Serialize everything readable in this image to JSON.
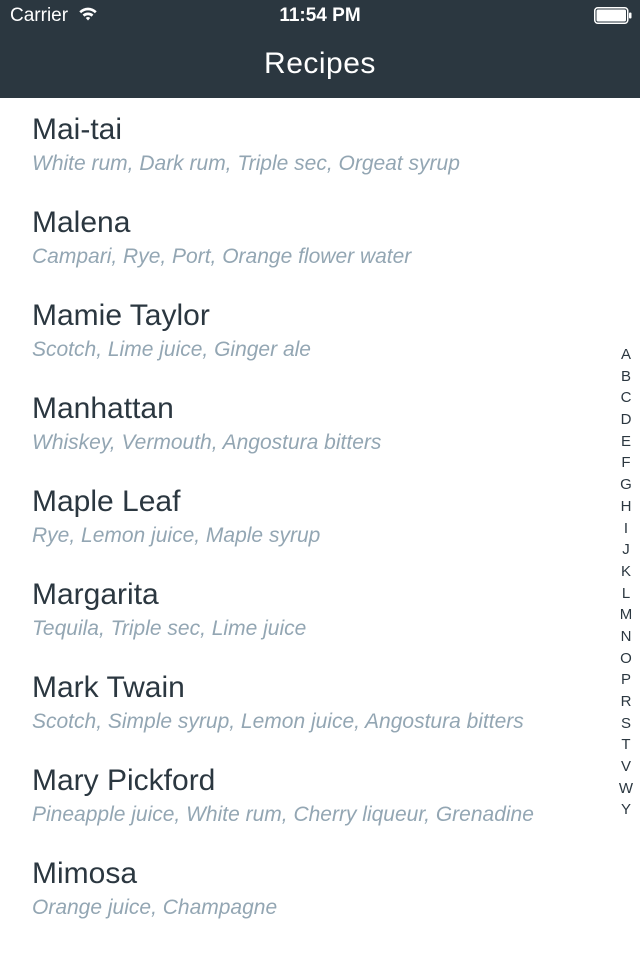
{
  "status_bar": {
    "carrier": "Carrier",
    "time": "11:54 PM",
    "wifi_icon": "wifi-icon",
    "battery_icon": "battery-icon"
  },
  "nav": {
    "title": "Recipes"
  },
  "recipes": [
    {
      "name": "Mai-tai",
      "ingredients": "White rum, Dark rum, Triple sec, Orgeat syrup"
    },
    {
      "name": "Malena",
      "ingredients": "Campari, Rye, Port, Orange flower water"
    },
    {
      "name": "Mamie Taylor",
      "ingredients": "Scotch, Lime juice, Ginger ale"
    },
    {
      "name": "Manhattan",
      "ingredients": "Whiskey, Vermouth, Angostura bitters"
    },
    {
      "name": "Maple Leaf",
      "ingredients": "Rye, Lemon juice, Maple syrup"
    },
    {
      "name": "Margarita",
      "ingredients": "Tequila, Triple sec, Lime juice"
    },
    {
      "name": "Mark Twain",
      "ingredients": "Scotch, Simple syrup, Lemon juice, Angostura bitters"
    },
    {
      "name": "Mary Pickford",
      "ingredients": "Pineapple juice, White rum, Cherry liqueur, Grenadine"
    },
    {
      "name": "Mimosa",
      "ingredients": "Orange juice, Champagne"
    }
  ],
  "index_letters": [
    "A",
    "B",
    "C",
    "D",
    "E",
    "F",
    "G",
    "H",
    "I",
    "J",
    "K",
    "L",
    "M",
    "N",
    "O",
    "P",
    "R",
    "S",
    "T",
    "V",
    "W",
    "Y"
  ],
  "colors": {
    "nav_background": "#2b3740",
    "title_text": "#2b3740",
    "subtitle_text": "#93a6b3"
  }
}
